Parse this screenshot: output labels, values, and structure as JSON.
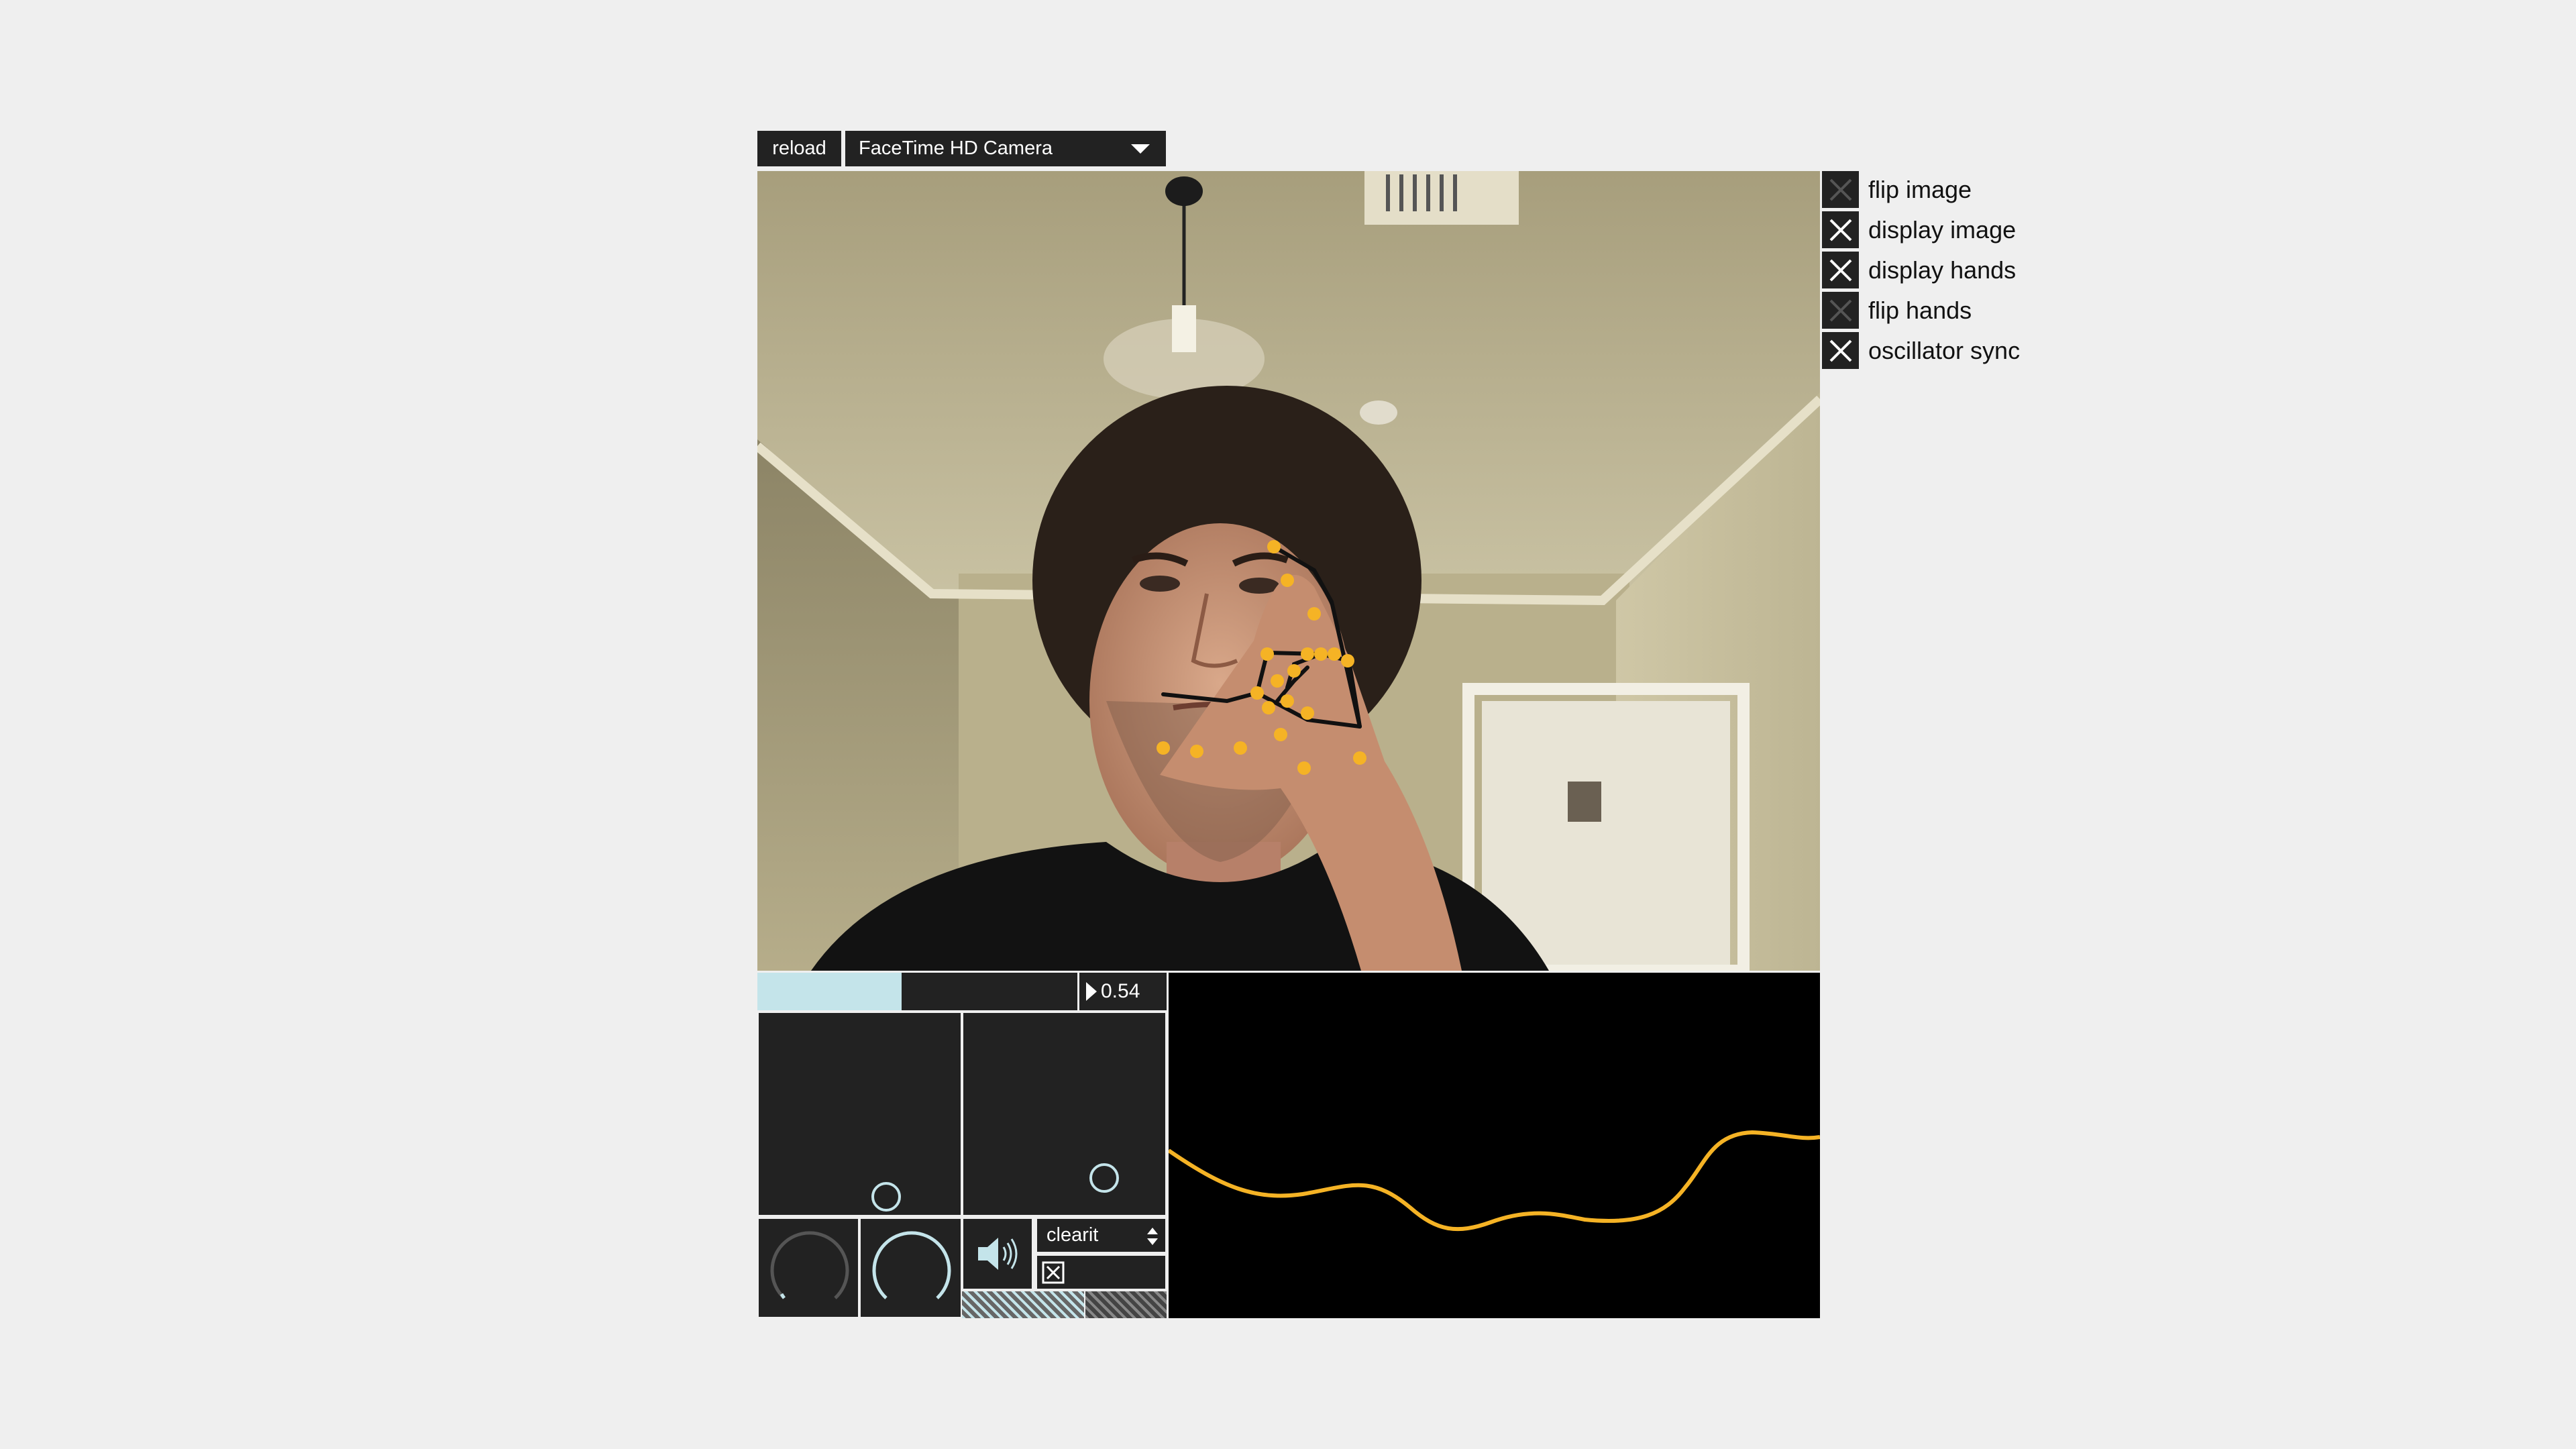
{
  "toolbar": {
    "reload_label": "reload",
    "camera_selected": "FaceTime HD Camera"
  },
  "options": [
    {
      "label": "flip image",
      "checked": false
    },
    {
      "label": "display image",
      "checked": true
    },
    {
      "label": "display hands",
      "checked": true
    },
    {
      "label": "flip hands",
      "checked": false
    },
    {
      "label": "oscillator sync",
      "checked": true
    }
  ],
  "controls": {
    "slider_level": 0.45,
    "number_value": "0.54",
    "menu_selected": "clearit",
    "toggle_checked": true
  },
  "colors": {
    "panel": "#222222",
    "accent": "#c4e4ea",
    "hand_landmark": "#f5b325",
    "waveform": "#f5b325"
  },
  "icons": [
    "dropdown-caret-icon",
    "x-check-icon",
    "speaker-icon",
    "number-play-triangle-icon",
    "menu-arrows-icon"
  ]
}
